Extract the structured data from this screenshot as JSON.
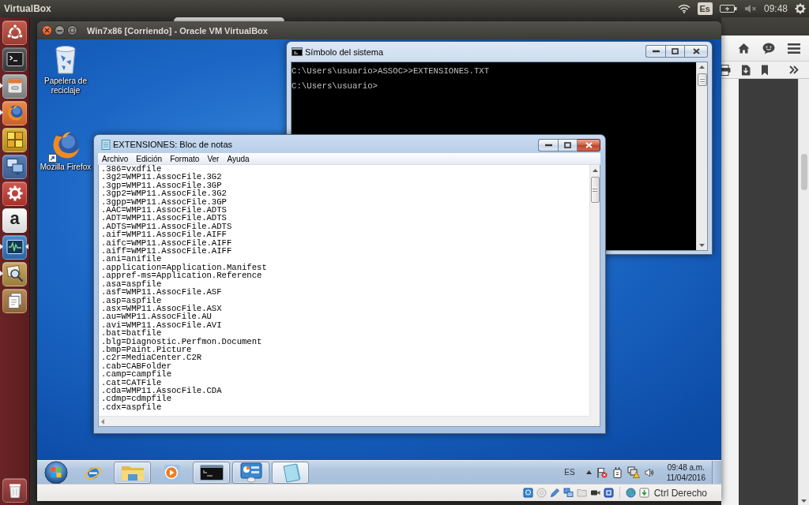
{
  "top_panel": {
    "app_name": "VirtualBox",
    "keyboard_layout": "Es",
    "clock": "09:48"
  },
  "launcher": [
    {
      "kind": "dash",
      "running": false,
      "focused": false
    },
    {
      "kind": "terminal",
      "running": false,
      "focused": false
    },
    {
      "kind": "files",
      "running": true,
      "focused": false
    },
    {
      "kind": "firefox",
      "running": true,
      "focused": false
    },
    {
      "kind": "cubes",
      "running": false,
      "focused": false
    },
    {
      "kind": "network",
      "running": false,
      "focused": false
    },
    {
      "kind": "settings",
      "running": false,
      "focused": false
    },
    {
      "kind": "letter",
      "glyph": "a",
      "running": false,
      "focused": false
    },
    {
      "kind": "monitor",
      "running": true,
      "focused": true
    },
    {
      "kind": "photos",
      "running": true,
      "focused": false
    },
    {
      "kind": "stack",
      "running": false,
      "focused": false
    },
    {
      "kind": "trash",
      "running": false,
      "focused": false
    }
  ],
  "vm_window": {
    "title": "Win7x86 [Corriendo] - Oracle VM VirtualBox",
    "host_key": "Ctrl Derecho"
  },
  "desktop_icons": [
    {
      "kind": "recycle-bin",
      "label": "Papelera de reciclaje"
    },
    {
      "kind": "firefox",
      "label": "Mozilla Firefox"
    }
  ],
  "cmd_window": {
    "title": "Símbolo del sistema",
    "active": false,
    "lines": [
      "C:\\Users\\usuario>ASSOC>>EXTENSIONES.TXT",
      "C:\\Users\\usuario>"
    ]
  },
  "notepad_window": {
    "title": "EXTENSIONES: Bloc de notas",
    "active": true,
    "menu": [
      "Archivo",
      "Edición",
      "Formato",
      "Ver",
      "Ayuda"
    ],
    "lines": [
      ".386=vxdfile",
      ".3g2=WMP11.AssocFile.3G2",
      ".3gp=WMP11.AssocFile.3GP",
      ".3gp2=WMP11.AssocFile.3G2",
      ".3gpp=WMP11.AssocFile.3GP",
      ".AAC=WMP11.AssocFile.ADTS",
      ".ADT=WMP11.AssocFile.ADTS",
      ".ADTS=WMP11.AssocFile.ADTS",
      ".aif=WMP11.AssocFile.AIFF",
      ".aifc=WMP11.AssocFile.AIFF",
      ".aiff=WMP11.AssocFile.AIFF",
      ".ani=anifile",
      ".application=Application.Manifest",
      ".appref-ms=Application.Reference",
      ".asa=aspfile",
      ".asf=WMP11.AssocFile.ASF",
      ".asp=aspfile",
      ".asx=WMP11.AssocFile.ASX",
      ".au=WMP11.AssocFile.AU",
      ".avi=WMP11.AssocFile.AVI",
      ".bat=batfile",
      ".blg=Diagnostic.Perfmon.Document",
      ".bmp=Paint.Picture",
      ".c2r=MediaCenter.C2R",
      ".cab=CABFolder",
      ".camp=campfile",
      ".cat=CATFile",
      ".cda=WMP11.AssocFile.CDA",
      ".cdmp=cdmpfile",
      ".cdx=aspfile"
    ]
  },
  "taskbar": {
    "buttons": [
      {
        "kind": "ie",
        "running": false,
        "active": false
      },
      {
        "kind": "explorer",
        "running": true,
        "active": false
      },
      {
        "kind": "media-player",
        "running": false,
        "active": false
      },
      {
        "kind": "cmd",
        "running": true,
        "active": false
      },
      {
        "kind": "control-panel",
        "running": true,
        "active": false
      },
      {
        "kind": "notepad",
        "running": true,
        "active": true
      }
    ],
    "language": "ES",
    "time": "09:48 a.m.",
    "date": "11/04/2016"
  }
}
